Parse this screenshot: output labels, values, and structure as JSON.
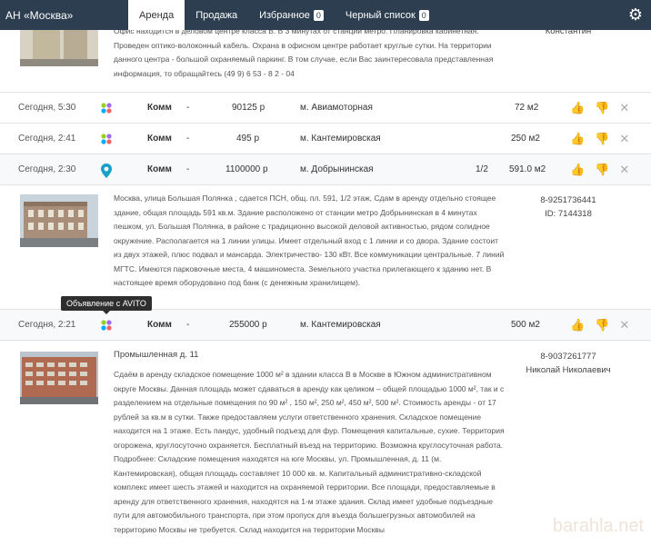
{
  "app": {
    "title": "АН «Москва»"
  },
  "nav": {
    "tabs": [
      {
        "label": "Аренда"
      },
      {
        "label": "Продажа"
      },
      {
        "label": "Избранное",
        "badge": "0"
      },
      {
        "label": "Черный список",
        "badge": "0"
      }
    ],
    "settings_icon": "gear-icon"
  },
  "top_detail": {
    "text": "Офис находится в деловом центре класса В. В 3 минутах от станции метро. Планировка кабинетная. Проведен оптико-волоконный кабель. Охрана в офисном центре работает круглые сутки. На территории данного центра - большой охраняемый паркинг. В том случае, если Вас заинтересовала представленная информация, то обращайтесь (49 9) 6 53 - 8 2 - 04",
    "contact_name": "Константин"
  },
  "rows": [
    {
      "date": "Сегодня, 5:30",
      "type": "Комм",
      "dash": "-",
      "price": "90125 р",
      "metro": "м. Авиамоторная",
      "floor": "",
      "area": "72 м2",
      "source_icon": "avito-dots-icon"
    },
    {
      "date": "Сегодня, 2:41",
      "type": "Комм",
      "dash": "-",
      "price": "495 р",
      "metro": "м. Кантемировская",
      "floor": "",
      "area": "250 м2",
      "source_icon": "avito-dots-icon"
    },
    {
      "date": "Сегодня, 2:30",
      "type": "Комм",
      "dash": "-",
      "price": "1100000 р",
      "metro": "м. Добрынинская",
      "floor": "1/2",
      "area": "591.0 м2",
      "source_icon": "map-pin-icon"
    },
    {
      "date": "Сегодня, 2:21",
      "type": "Комм",
      "dash": "-",
      "price": "255000 р",
      "metro": "м. Кантемировская",
      "floor": "",
      "area": "500 м2",
      "source_icon": "avito-dots-icon"
    }
  ],
  "detail_1": {
    "text": "Москва, улица Большая Полянка , сдается ПСН, общ. пл. 591, 1/2 этаж, Сдам в аренду отдельно стоящее здание, общая площадь 591 кв.м. Здание расположено от станции метро Добрынинская в 4 минутах пешком, ул. Большая Полянка, в районе с традиционно высокой деловой активностью, рядом солидное окружение. Располагается на 1 линии улицы. Имеет отдельный вход с 1 линии и со двора. Здание состоит из двух этажей, плюс подвал и мансарда. Электричество- 130 кВт. Все коммуникации центральные. 7 линий МГТС. Имеются парковочные места, 4 машиноместа. Земельного участка прилегающего к зданию нет. В настоящее время оборудовано под банк (с денежным хранилищем).",
    "phone": "8-9251736441",
    "id": "ID: 7144318"
  },
  "tooltip": "Объявление с AVITO",
  "detail_2": {
    "address": "Промышленная д. 11",
    "text": "Сдаём в аренду складское помещение 1000 м² в здании класса В в Москве в Южном административном округе Москвы. Данная площадь может сдаваться в аренду как целиком – общей площадью 1000 м², так и с разделением на отдельные помещения по 90 м² , 150 м², 250 м², 450 м², 500 м². Стоимость аренды - от 17 рублей за кв.м в сутки. Также предоставляем услуги ответственного хранения. Складское помещение находится на 1 этаже. Есть пандус, удобный подъезд для фур. Помещения капитальные, сухие. Территория огорожена, круглосуточно охраняется. Бесплатный въезд на территорию. Возможна круглосуточная работа. Подробнее: Складские помещения находятся на юге Москвы, ул. Промышленная, д. 11 (м. Кантемировская), общая площадь составляет 10 000 кв. м. Капитальный административно-складской комплекс имеет шесть этажей и находится на охраняемой территории. Все площади, предоставляемые в аренду для ответственного хранения, находятся на 1-м этаже здания. Склад имеет удобные подъездные пути для автомобильного транспорта, при этом пропуск для въезда большегрузных автомобилей на территорию Москвы не требуется. Склад находится на территории Москвы",
    "phone": "8-9037261777",
    "contact_name": "Николай Николаевич"
  },
  "watermark": "barahla.net"
}
